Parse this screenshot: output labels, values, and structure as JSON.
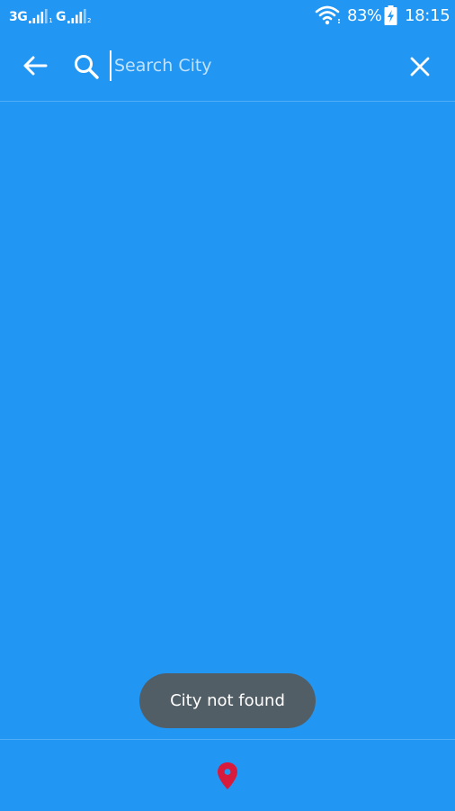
{
  "status_bar": {
    "sim1_network": "3G",
    "sim1_index": "1",
    "sim2_network": "G",
    "sim2_index": "2",
    "battery_percent": "83%",
    "time": "18:15"
  },
  "search": {
    "placeholder": "Search City",
    "value": ""
  },
  "toast": {
    "message": "City not found"
  },
  "icons": {
    "back": "arrow-left-icon",
    "search": "search-icon",
    "clear": "close-icon",
    "location": "location-pin-icon",
    "wifi": "wifi-icon",
    "battery": "battery-charging-icon"
  },
  "colors": {
    "background": "#2196F3",
    "toast": "#525E66",
    "location_pin": "#D81B3C",
    "foreground": "#FFFFFF"
  }
}
